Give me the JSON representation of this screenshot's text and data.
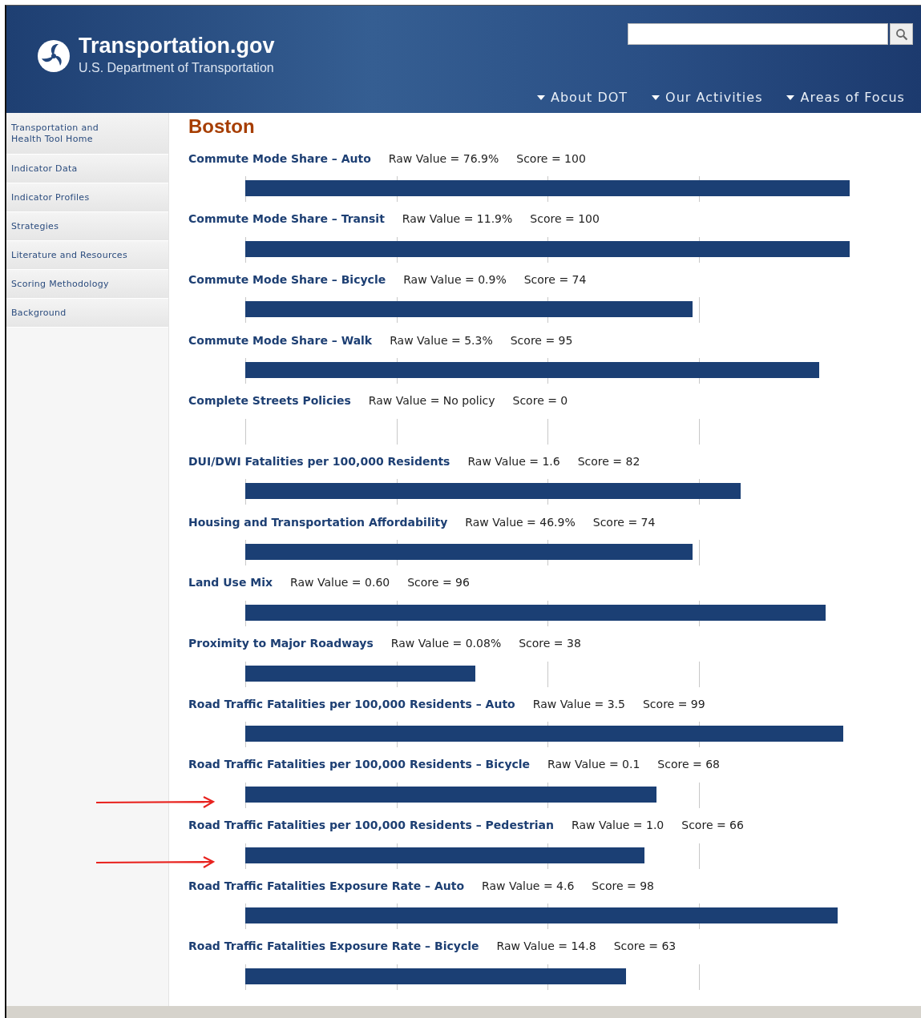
{
  "header": {
    "site_title": "Transportation.gov",
    "site_subtitle": "U.S. Department of Transportation",
    "nav": [
      "About DOT",
      "Our Activities",
      "Areas of Focus"
    ]
  },
  "sidebar": {
    "items": [
      {
        "label": "Transportation and Health Tool Home"
      },
      {
        "label": "Indicator Data"
      },
      {
        "label": "Indicator Profiles"
      },
      {
        "label": "Strategies"
      },
      {
        "label": "Literature and Resources"
      },
      {
        "label": "Scoring Methodology"
      },
      {
        "label": "Background"
      }
    ]
  },
  "page_title": "Boston",
  "indicators": [
    {
      "name": "Commute Mode Share – Auto",
      "raw": "Raw Value = 76.9%",
      "score": "Score = 100",
      "level": 1.0,
      "flagged": false
    },
    {
      "name": "Commute Mode Share – Transit",
      "raw": "Raw Value = 11.9%",
      "score": "Score = 100",
      "level": 1.0,
      "flagged": false
    },
    {
      "name": "Commute Mode Share – Bicycle",
      "raw": "Raw Value = 0.9%",
      "score": "Score = 74",
      "level": 0.74,
      "flagged": false
    },
    {
      "name": "Commute Mode Share – Walk",
      "raw": "Raw Value = 5.3%",
      "score": "Score = 95",
      "level": 0.95,
      "flagged": false
    },
    {
      "name": "Complete Streets Policies",
      "raw": "Raw Value = No policy",
      "score": "Score = 0",
      "flagged": false
    },
    {
      "name": "DUI/DWI Fatalities per 100,000 Residents",
      "raw": "Raw Value = 1.6",
      "score": "Score = 82",
      "level": 0.82,
      "flagged": false
    },
    {
      "name": "Housing and Transportation Affordability",
      "raw": "Raw Value = 46.9%",
      "score": "Score = 74",
      "level": 0.74,
      "flagged": false
    },
    {
      "name": "Land Use Mix",
      "raw": "Raw Value = 0.60",
      "score": "Score = 96",
      "level": 0.96,
      "flagged": false
    },
    {
      "name": "Proximity to Major Roadways",
      "raw": "Raw Value = 0.08%",
      "score": "Score = 38",
      "level": 0.38,
      "flagged": false
    },
    {
      "name": "Road Traffic Fatalities per 100,000 Residents – Auto",
      "raw": "Raw Value = 3.5",
      "score": "Score = 99",
      "level": 0.99,
      "flagged": false
    },
    {
      "name": "Road Traffic Fatalities per 100,000 Residents – Bicycle",
      "raw": "Raw Value = 0.1",
      "score": "Score = 68",
      "level": 0.68,
      "flagged": true
    },
    {
      "name": "Road Traffic Fatalities per 100,000 Residents – Pedestrian",
      "raw": "Raw Value = 1.0",
      "score": "Score = 66",
      "level": 0.66,
      "flagged": true
    },
    {
      "name": "Road Traffic Fatalities Exposure Rate – Auto",
      "raw": "Raw Value = 4.6",
      "score": "Score = 98",
      "level": 0.98,
      "flagged": false
    },
    {
      "name": "Road Traffic Fatalities Exposure Rate – Bicycle",
      "raw": "Raw Value = 14.8",
      "score": "Score = 63",
      "level": 0.63,
      "flagged": false
    }
  ]
}
